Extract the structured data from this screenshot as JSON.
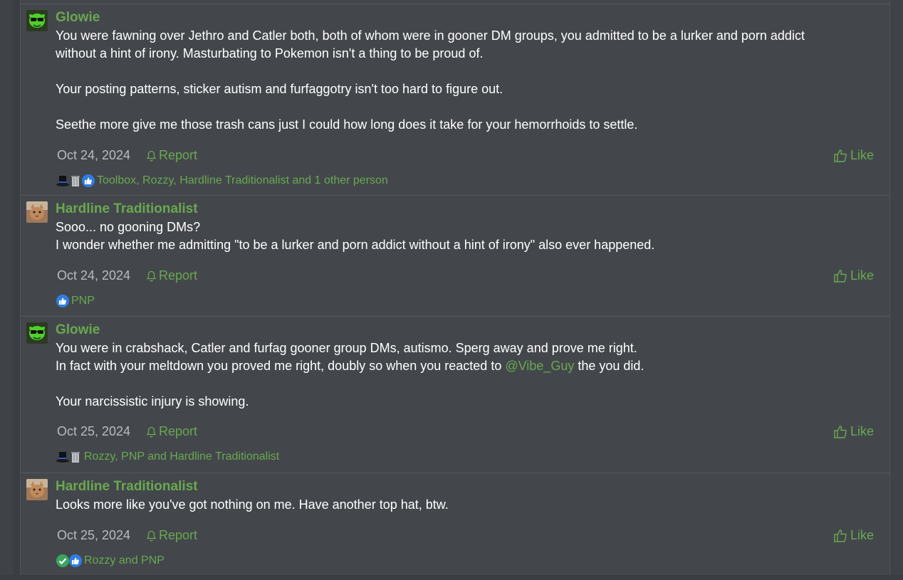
{
  "posts": [
    {
      "author": "Glowie",
      "avatar_icon": "green-alien-glasses-avatar",
      "lines": [
        "You were fawning over Jethro and Catler both, both of whom were in gooner DM groups, you admitted to be a lurker and porn addict",
        "without a hint of irony. Masturbating to Pokemon isn't a thing to be proud of.",
        "",
        "Your posting patterns, sticker autism and furfaggotry isn't too hard to figure out.",
        "",
        "Seethe more give me those trash cans just I could how long does it take for your hemorrhoids to settle."
      ],
      "date": "Oct 24, 2024",
      "report_label": "Report",
      "like_label": "Like",
      "reaction_icons": [
        "top-hat-icon",
        "trash-can-icon",
        "thumbs-up-icon"
      ],
      "reactions_text": "Toolbox, Rozzy, Hardline Traditionalist and 1 other person"
    },
    {
      "author": "Hardline Traditionalist",
      "avatar_icon": "cat-photo-avatar",
      "lines": [
        "Sooo... no gooning DMs?",
        "I wonder whether me admitting \"to be a lurker and porn addict without a hint of irony\" also ever happened."
      ],
      "date": "Oct 24, 2024",
      "report_label": "Report",
      "like_label": "Like",
      "reaction_icons": [
        "thumbs-up-icon"
      ],
      "reactions_text": "PNP"
    },
    {
      "author": "Glowie",
      "avatar_icon": "green-alien-glasses-avatar",
      "lines_before_mention": "You were in crabshack, Catler and furfag gooner group DMs, autismo. Sperg away and prove me right.",
      "line2_prefix": "In fact with your meltdown you proved me right, doubly so when you reacted to ",
      "mention": "@Vibe_Guy",
      "line2_suffix": " the you did.",
      "line_last": "Your narcissistic injury is showing.",
      "date": "Oct 25, 2024",
      "report_label": "Report",
      "like_label": "Like",
      "reaction_icons": [
        "top-hat-icon",
        "trash-can-icon"
      ],
      "reactions_text": "Rozzy, PNP and Hardline Traditionalist"
    },
    {
      "author": "Hardline Traditionalist",
      "avatar_icon": "cat-photo-avatar",
      "lines": [
        "Looks more like you've got nothing on me. Have another top hat, btw."
      ],
      "date": "Oct 25, 2024",
      "report_label": "Report",
      "like_label": "Like",
      "reaction_icons": [
        "check-badge-icon",
        "thumbs-up-icon"
      ],
      "reactions_text": "Rozzy and PNP"
    }
  ],
  "colors": {
    "accent": "#6aa84f",
    "background": "#43474c",
    "text": "#ffffff",
    "muted": "#b8bbbf"
  }
}
